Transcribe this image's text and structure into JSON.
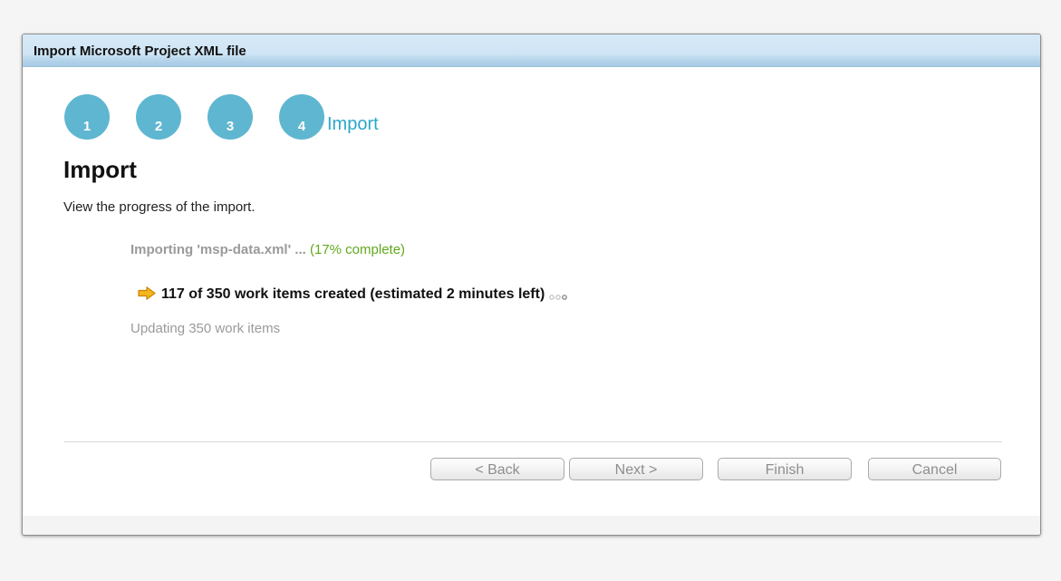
{
  "dialog": {
    "title": "Import Microsoft Project XML file"
  },
  "steps": [
    {
      "number": "1"
    },
    {
      "number": "2"
    },
    {
      "number": "3"
    },
    {
      "number": "4"
    }
  ],
  "current_step_label": "Import",
  "page": {
    "heading": "Import",
    "description": "View the progress of the import."
  },
  "progress": {
    "file_text": "Importing 'msp-data.xml' ...",
    "percent_text": "(17% complete)",
    "current_task": "117 of 350 work items created (estimated 2 minutes left)",
    "pending_task": "Updating 350 work items"
  },
  "buttons": {
    "back": "< Back",
    "next": "Next >",
    "finish": "Finish",
    "cancel": "Cancel"
  },
  "colors": {
    "step_circle": "#5fb6d0",
    "step_label": "#2ba7c9",
    "percent": "#62a81c",
    "arrow": "#f2a516"
  }
}
